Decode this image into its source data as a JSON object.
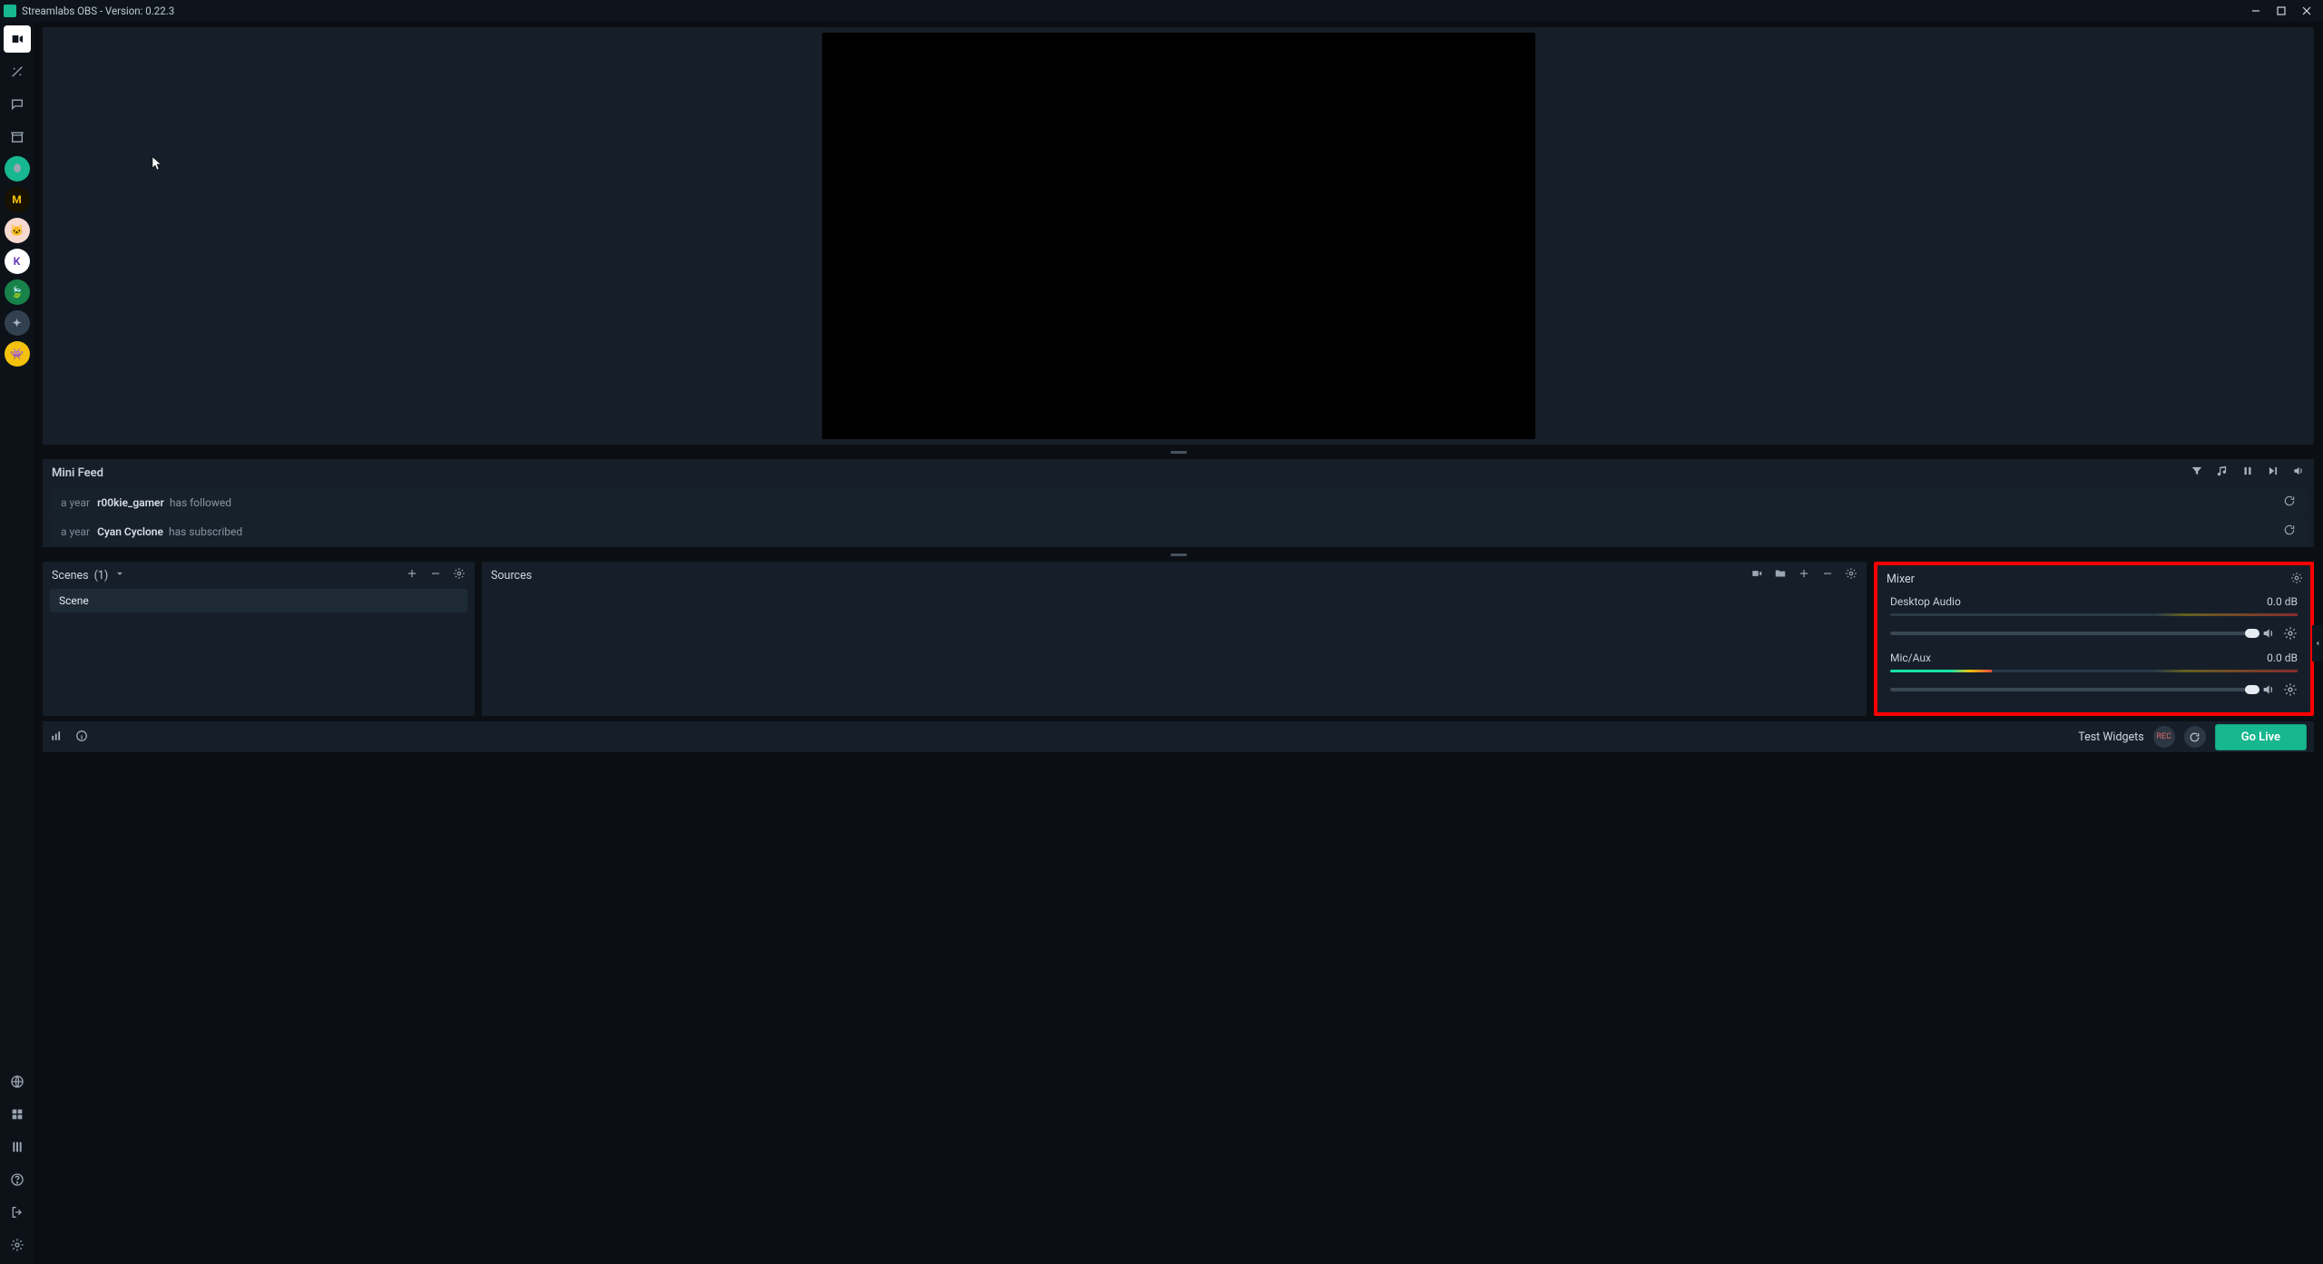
{
  "window": {
    "title": "Streamlabs OBS - Version: 0.22.3"
  },
  "preview": {
    "cursor_visible": true
  },
  "mini_feed": {
    "title": "Mini Feed",
    "events": [
      {
        "time": "a year",
        "user": "r00kie_gamer",
        "action": "has followed"
      },
      {
        "time": "a year",
        "user": "Cyan Cyclone",
        "action": "has subscribed"
      }
    ]
  },
  "scenes": {
    "title": "Scenes",
    "count": "(1)",
    "items": [
      {
        "name": "Scene"
      }
    ]
  },
  "sources": {
    "title": "Sources"
  },
  "mixer": {
    "title": "Mixer",
    "highlighted": true,
    "channels": [
      {
        "name": "Desktop Audio",
        "db": "0.0 dB",
        "meter_percent": 0,
        "slider_percent": 100
      },
      {
        "name": "Mic/Aux",
        "db": "0.0 dB",
        "meter_percent": 25,
        "slider_percent": 100
      }
    ]
  },
  "statusbar": {
    "test_widgets": "Test Widgets",
    "rec_label": "REC",
    "go_live": "Go Live"
  },
  "rail": {
    "apps": [
      {
        "name": "streamlabs-app",
        "bg": "#17b790",
        "fg": "#0b0f14",
        "text": ""
      },
      {
        "name": "app-m",
        "bg": "#1a1200",
        "fg": "#f4c20d",
        "text": "M"
      },
      {
        "name": "app-cat",
        "bg": "#f7d9d0",
        "fg": "#7a4a3a",
        "text": ""
      },
      {
        "name": "app-k",
        "bg": "#ffffff",
        "fg": "#6c3fb5",
        "text": "K"
      },
      {
        "name": "app-leaf",
        "bg": "#17834a",
        "fg": "#e6f7ee",
        "text": ""
      },
      {
        "name": "app-puzzle",
        "bg": "#32414f",
        "fg": "#aab4be",
        "text": ""
      },
      {
        "name": "app-monster",
        "bg": "#f4c20d",
        "fg": "#1a1a1a",
        "text": ""
      }
    ]
  },
  "colors": {
    "accent": "#17b790",
    "bg_panel": "#161f29",
    "bg_app": "#0b0f14",
    "highlight_border": "#ff0000"
  }
}
